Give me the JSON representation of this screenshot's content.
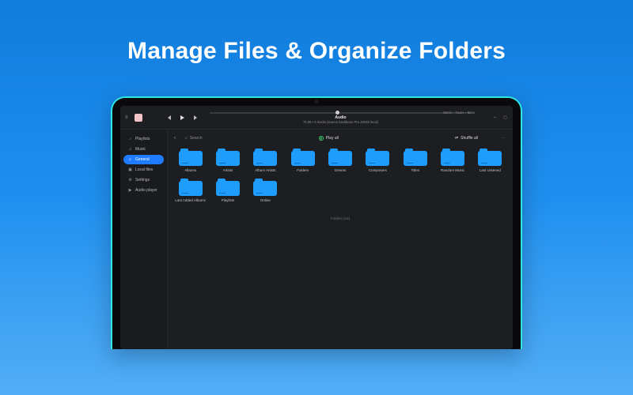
{
  "headline": "Manage Files & Organize Folders",
  "player": {
    "track_title": "Audio",
    "track_sub": "72.96 • 6 tracks (source backbone Pro 48228 local)",
    "now_line": "Merlo – Tuxer – Moto"
  },
  "sidebar": {
    "items": [
      {
        "icon": "♪",
        "label": "Playlists"
      },
      {
        "icon": "♫",
        "label": "Music"
      },
      {
        "icon": "⌕",
        "label": "General"
      },
      {
        "icon": "▣",
        "label": "Local files"
      },
      {
        "icon": "⚙",
        "label": "Settings"
      },
      {
        "icon": "▶",
        "label": "Audio player"
      }
    ]
  },
  "toolbar": {
    "search_label": "Search",
    "play_all": "Play all",
    "shuffle_all": "Shuffle all"
  },
  "folders_row1": [
    "Albums",
    "Artists",
    "Album Artists",
    "Folders",
    "Genres",
    "Composers",
    "Titles",
    "Random Music",
    "Last Listened"
  ],
  "folders_row2": [
    "Last Added Albums",
    "Playlists",
    "Online"
  ],
  "footer": "Folders (14)"
}
